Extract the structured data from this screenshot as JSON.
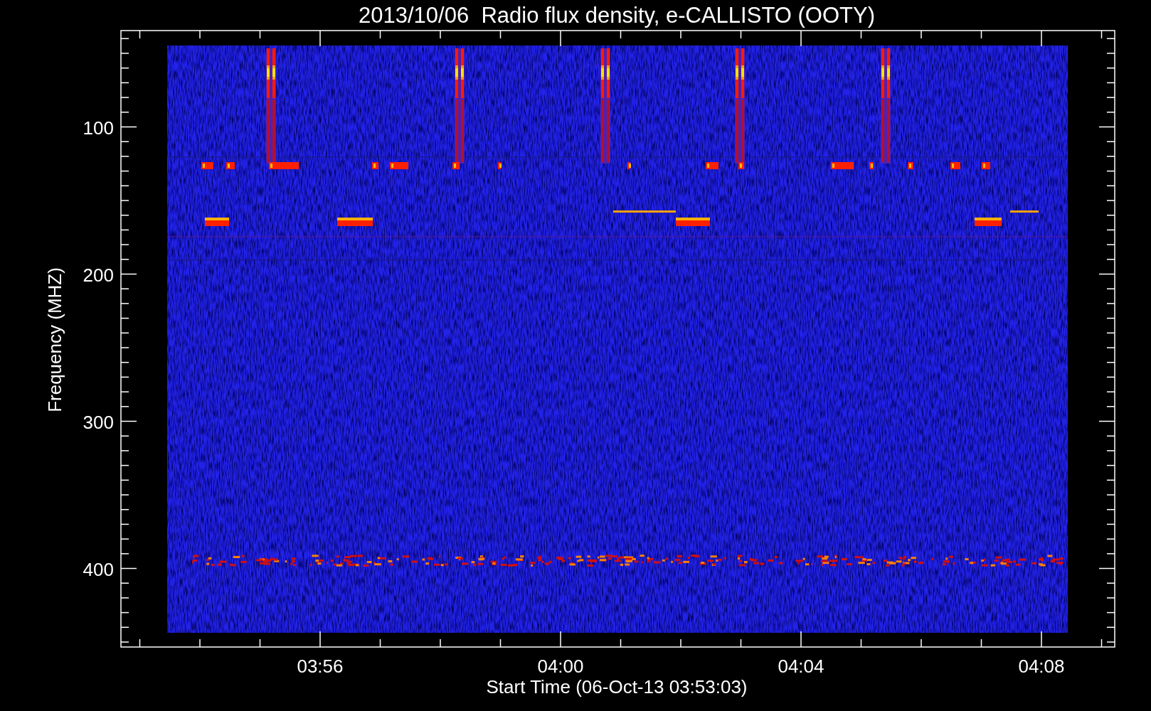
{
  "title": "2013/10/06  Radio flux density, e-CALLISTO (OOTY)",
  "ylabel": "Frequency (MHZ)",
  "xlabel": "Start Time (06-Oct-13 03:53:03)",
  "yticks": [
    "100",
    "200",
    "300",
    "400"
  ],
  "xticks": [
    "03:56",
    "04:00",
    "04:04",
    "04:08"
  ]
}
